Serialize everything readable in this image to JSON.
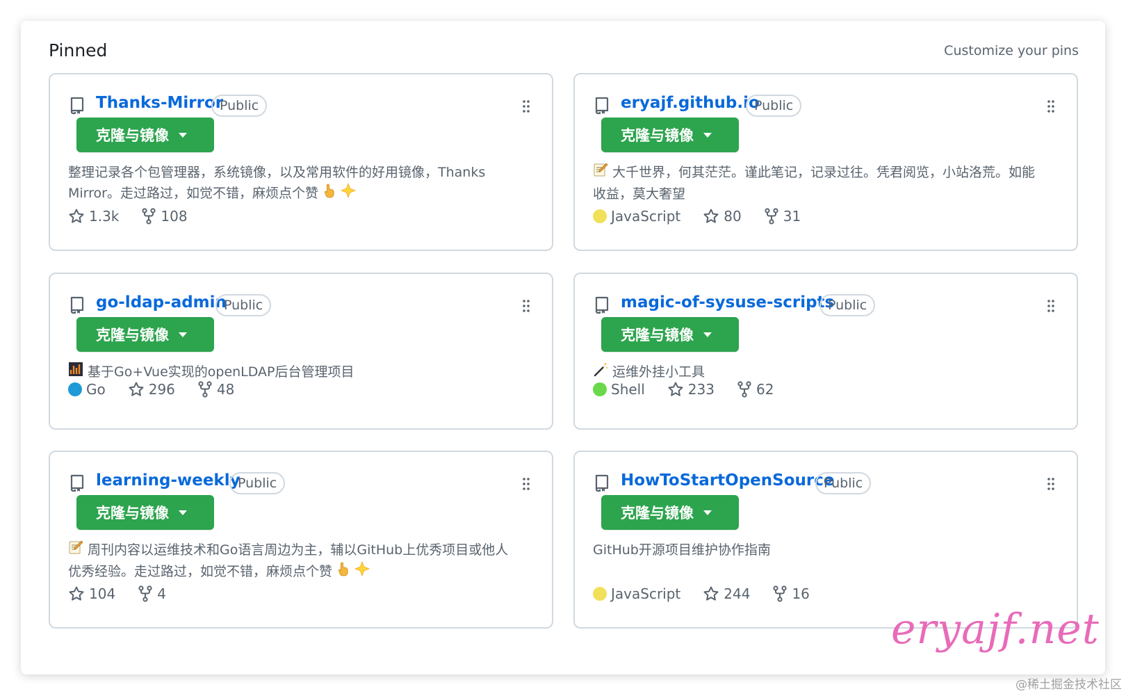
{
  "header": {
    "title": "Pinned",
    "customize": "Customize your pins"
  },
  "clone_label": "克隆与镜像",
  "colors": {
    "accent": "#0969da",
    "button": "#2da44e",
    "js": "#f1e05a",
    "go": "#00ADD8",
    "shell": "#89e051",
    "watermark": "#e86bb9"
  },
  "cards": [
    {
      "name": "Thanks-Mirror",
      "visibility": "Public",
      "description_line1": "整理记录各个包管理器，系统镜像，以及常用软件的好用镜像，Thanks",
      "description_line2": "Mirror。走过路过，如觉不错，麻烦点个赞",
      "language": "",
      "stars": "1.3k",
      "forks": "108"
    },
    {
      "name": "eryajf.github.io",
      "visibility": "Public",
      "description_line1": "大千世界，何其茫茫。谨此笔记，记录过往。凭君阅览，小站洛荒。如能",
      "description_line2": "收益，莫大奢望",
      "language": "JavaScript",
      "stars": "80",
      "forks": "31"
    },
    {
      "name": "go-ldap-admin",
      "visibility": "Public",
      "description_line1": "基于Go+Vue实现的openLDAP后台管理项目",
      "description_line2": "",
      "language": "Go",
      "stars": "296",
      "forks": "48"
    },
    {
      "name": "magic-of-sysuse-scripts",
      "visibility": "Public",
      "description_line1": "运维外挂小工具",
      "description_line2": "",
      "language": "Shell",
      "stars": "233",
      "forks": "62"
    },
    {
      "name": "learning-weekly",
      "visibility": "Public",
      "description_line1": "周刊内容以运维技术和Go语言周边为主，辅以GitHub上优秀项目或他人",
      "description_line2": "优秀经验。走过路过，如觉不错，麻烦点个赞",
      "language": "",
      "stars": "104",
      "forks": "4"
    },
    {
      "name": "HowToStartOpenSource",
      "visibility": "Public",
      "description_line1": "GitHub开源项目维护协作指南",
      "description_line2": "",
      "language": "JavaScript",
      "stars": "244",
      "forks": "16"
    }
  ],
  "watermark": "eryajf.net",
  "credit": "@稀土掘金技术社区"
}
